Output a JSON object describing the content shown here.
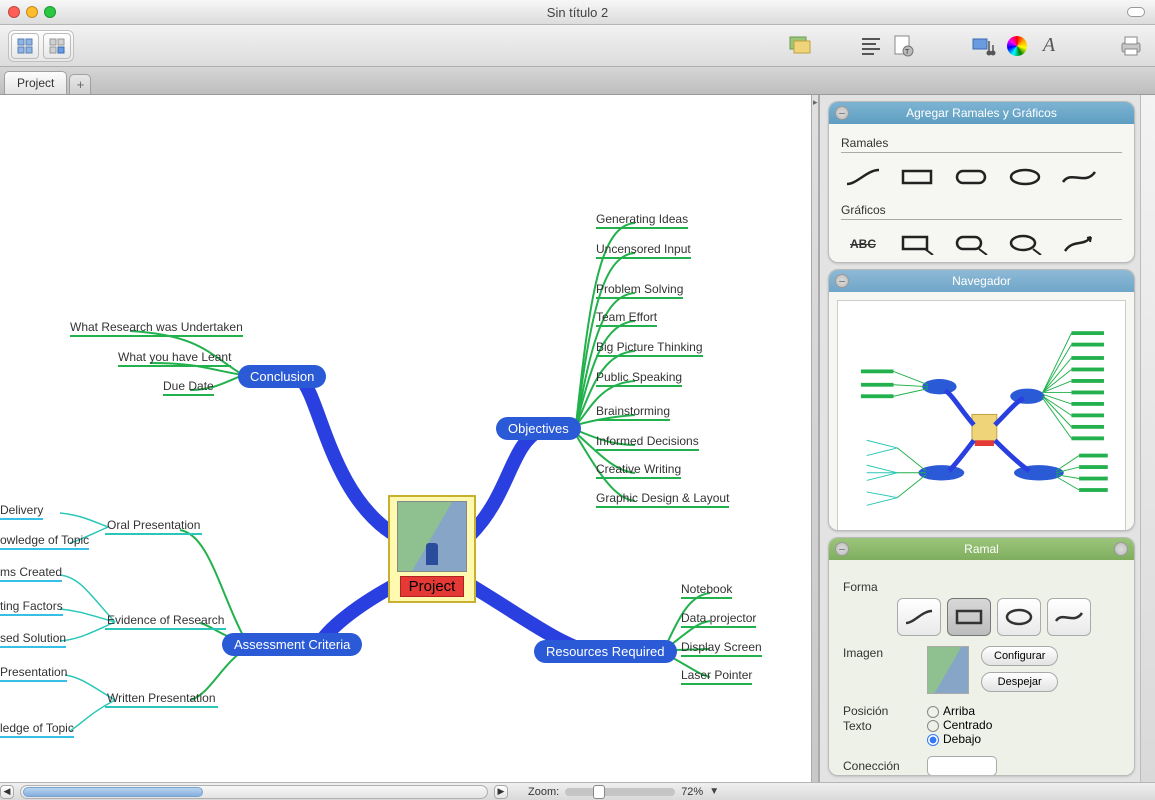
{
  "window": {
    "title": "Sin título 2"
  },
  "tabs": {
    "active": "Project"
  },
  "statusbar": {
    "zoom_label": "Zoom:",
    "zoom_value": "72%"
  },
  "mindmap": {
    "center": "Project",
    "branches": {
      "conclusion": {
        "label": "Conclusion",
        "leaves": [
          "What Research was Undertaken",
          "What you have Leant",
          "Due Date"
        ]
      },
      "objectives": {
        "label": "Objectives",
        "leaves": [
          "Generating Ideas",
          "Uncensored Input",
          "Problem Solving",
          "Team Effort",
          "Big Picture Thinking",
          "Public Speaking",
          "Brainstorming",
          "Informed Decisions",
          "Creative Writing",
          "Graphic Design & Layout"
        ]
      },
      "assessment": {
        "label": "Assessment Criteria",
        "sub": {
          "oral": {
            "label": "Oral Presentation",
            "leaves": [
              "Delivery",
              "owledge of Topic"
            ]
          },
          "evidence": {
            "label": "Evidence of Research",
            "leaves": [
              "ms Created",
              "ting Factors",
              "sed Solution"
            ]
          },
          "written": {
            "label": "Written Presentation",
            "leaves": [
              "Presentation",
              "ledge of Topic"
            ]
          }
        }
      },
      "resources": {
        "label": "Resources Required",
        "leaves": [
          "Notebook",
          "Data projector",
          "Display Screen",
          "Laser Pointer"
        ]
      }
    }
  },
  "panels": {
    "add": {
      "title": "Agregar Ramales y Gráficos",
      "section1": "Ramales",
      "section2": "Gráficos",
      "abc": "ABC"
    },
    "nav": {
      "title": "Navegador"
    },
    "ramal": {
      "title": "Ramal",
      "forma": "Forma",
      "imagen": "Imagen",
      "configurar": "Configurar",
      "despejar": "Despejar",
      "posicion": "Posición Texto",
      "arriba": "Arriba",
      "centrado": "Centrado",
      "debajo": "Debajo",
      "coneccion": "Conección"
    }
  }
}
